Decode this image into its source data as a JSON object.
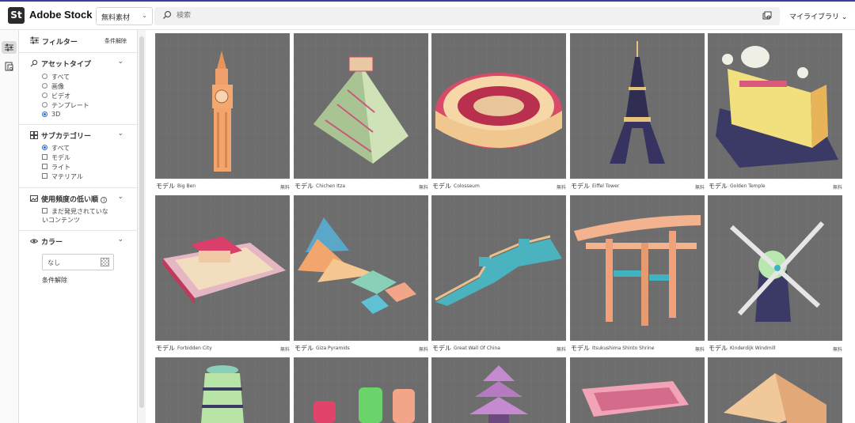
{
  "header": {
    "logo_mark": "St",
    "logo_text": "Adobe Stock",
    "asset_select": "無料素材",
    "search_placeholder": "検索",
    "library": "マイライブラリ"
  },
  "filters": {
    "title": "フィルター",
    "clear": "条件解除",
    "asset_type": {
      "title": "アセットタイプ",
      "options": [
        "すべて",
        "画像",
        "ビデオ",
        "テンプレート",
        "3D"
      ],
      "selected": "3D"
    },
    "subcategory": {
      "title": "サブカテゴリー",
      "options": [
        "すべて",
        "モデル",
        "ライト",
        "マテリアル"
      ],
      "selected": "すべて"
    },
    "usage": {
      "title": "使用頻度の低い順",
      "option_line1": "まだ発見されていな",
      "option_line2": "いコンテンツ"
    },
    "color": {
      "title": "カラー",
      "value": "なし",
      "clear": "条件解除"
    }
  },
  "results": {
    "kind_label": "モデル",
    "free_label": "無料",
    "items": [
      {
        "name": "Big Ben"
      },
      {
        "name": "Chichen Itza"
      },
      {
        "name": "Colosseum"
      },
      {
        "name": "Eiffel Tower"
      },
      {
        "name": "Golden Temple"
      },
      {
        "name": "Forbidden City"
      },
      {
        "name": "Giza Pyramids"
      },
      {
        "name": "Great Wall Of China"
      },
      {
        "name": "Itsukushima Shinto Shrine"
      },
      {
        "name": "Kinderdijk Windmill"
      }
    ]
  }
}
